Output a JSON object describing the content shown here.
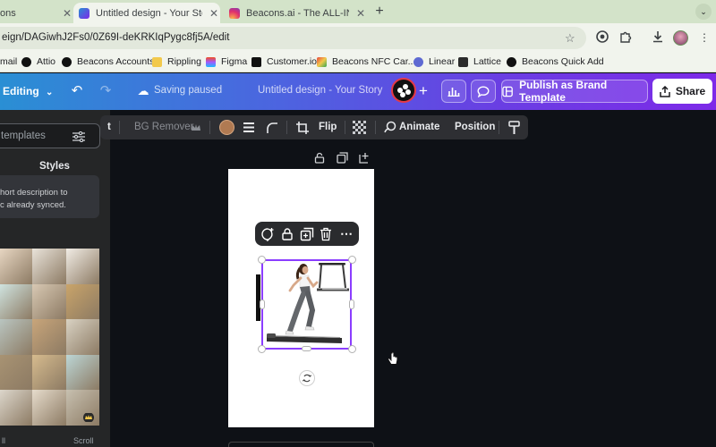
{
  "browser": {
    "tabs": [
      {
        "label": "ons",
        "active": false
      },
      {
        "label": "Untitled design - Your Story - C",
        "active": true
      },
      {
        "label": "Beacons.ai - The ALL-IN-ONE",
        "active": false
      }
    ],
    "new_tab_label": "+",
    "tab_menu_label": "⌄",
    "url": "eign/DAGiwhJ2Fs0/0Z69I-deKRKIqPygc8fj5A/edit",
    "bookmarks": [
      {
        "label": "mail",
        "color": "#ffffff"
      },
      {
        "label": "Attio",
        "color": "#111111"
      },
      {
        "label": "Beacons Accounts",
        "color": "#111111"
      },
      {
        "label": "Rippling",
        "color": "#f2c94c"
      },
      {
        "label": "Figma",
        "color": "#f24e1e"
      },
      {
        "label": "Customer.io",
        "color": "#111111"
      },
      {
        "label": "Beacons NFC Car...",
        "color": "#e8453c"
      },
      {
        "label": "Linear",
        "color": "#5e6ad2"
      },
      {
        "label": "Lattice",
        "color": "#2b2b2b"
      },
      {
        "label": "Beacons Quick Add",
        "color": "#111111"
      }
    ]
  },
  "canva": {
    "editing_label": "Editing",
    "saving_label": "Saving paused",
    "doc_title": "Untitled design - Your Story",
    "publish_label": "Publish as Brand Template",
    "share_label": "Share"
  },
  "panel": {
    "search_placeholder": "templates",
    "styles_tab": "Styles",
    "info_line_1": "hort description to",
    "info_line_2": "c already synced.",
    "bottom_left": "ll",
    "bottom_right": "Scroll",
    "thumb_colors": [
      "#e7d6c2",
      "#e9e3da",
      "#f1ece5",
      "#cfe3df",
      "#d8c8b3",
      "#c9a46a",
      "#b9c5c0",
      "#c8a57a",
      "#d9d2c3",
      "#a89373",
      "#d6bb8e",
      "#bcd6d6",
      "#dcd6cb",
      "#e6dccc",
      "#c7c0b0"
    ]
  },
  "toolbar": {
    "edit_label": "t",
    "bg_remover_label": "BG Remover",
    "crown_icon": "crown-icon",
    "color_swatch": "#b07a52",
    "flip_label": "Flip",
    "animate_label": "Animate",
    "position_label": "Position"
  },
  "accent": "#8b3dff"
}
